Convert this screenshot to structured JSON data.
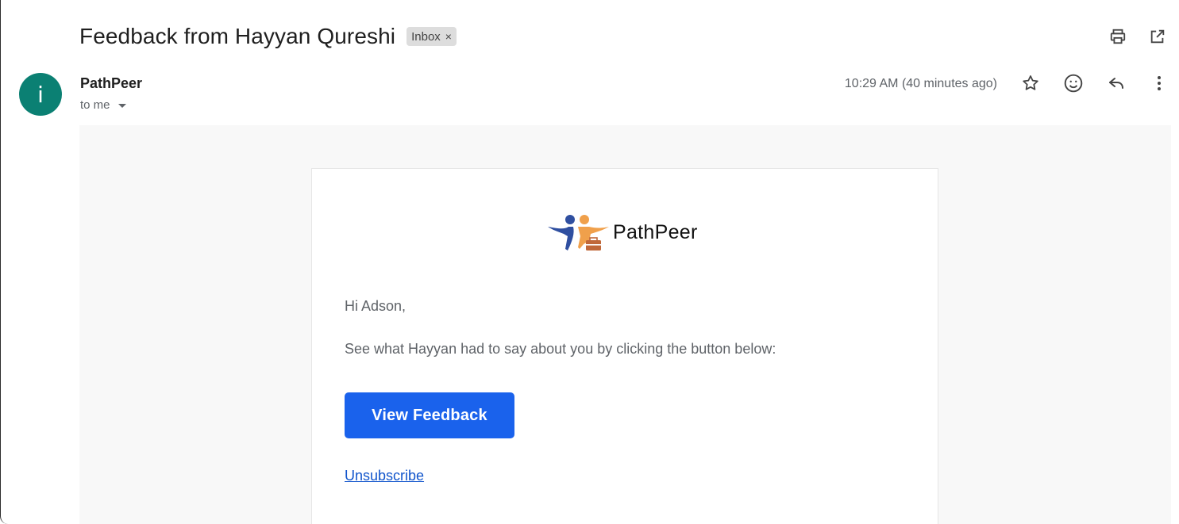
{
  "email": {
    "subject": "Feedback from Hayyan Qureshi",
    "label": "Inbox",
    "label_remove": "×",
    "sender": {
      "avatar_letter": "i",
      "name": "PathPeer",
      "recipient": "to me"
    },
    "time": "10:29 AM (40 minutes ago)"
  },
  "toolbar_icons": [
    "print-icon",
    "open-in-new-window-icon"
  ],
  "message_icons": [
    "star-icon",
    "emoji-react-icon",
    "reply-icon",
    "more-options-icon"
  ],
  "body": {
    "brand": "PathPeer",
    "greeting": "Hi Adson,",
    "message": "See what Hayyan had to say about you by clicking the button below:",
    "cta_label": "View Feedback",
    "unsubscribe_label": "Unsubscribe"
  },
  "colors": {
    "avatar": "#0b8073",
    "cta": "#1a62ec",
    "link": "#1155cc",
    "brand_blue": "#2f4fa0",
    "brand_orange": "#f0a04b"
  }
}
